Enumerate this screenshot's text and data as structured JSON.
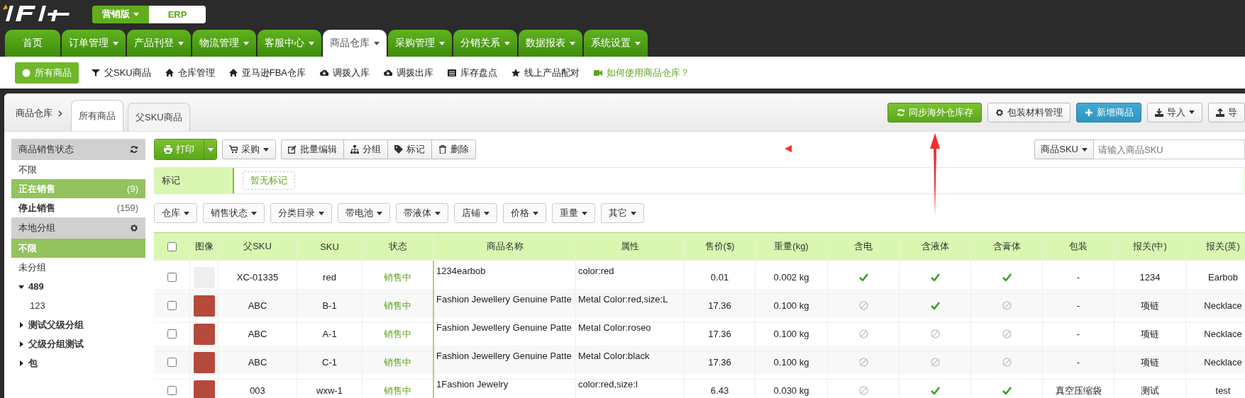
{
  "edition_switch": [
    {
      "label": "营销版",
      "kind": "dropdown",
      "selected": false
    },
    {
      "label": "ERP",
      "kind": "plain",
      "selected": true
    }
  ],
  "nav_tabs": [
    {
      "label": "首页",
      "dropdown": false,
      "selected": false
    },
    {
      "label": "订单管理",
      "dropdown": true,
      "selected": false
    },
    {
      "label": "产品刊登",
      "dropdown": true,
      "selected": false
    },
    {
      "label": "物流管理",
      "dropdown": true,
      "selected": false
    },
    {
      "label": "客服中心",
      "dropdown": true,
      "selected": false
    },
    {
      "label": "商品仓库",
      "dropdown": true,
      "selected": true
    },
    {
      "label": "采购管理",
      "dropdown": true,
      "selected": false
    },
    {
      "label": "分销关系",
      "dropdown": true,
      "selected": false
    },
    {
      "label": "数据报表",
      "dropdown": true,
      "selected": false
    },
    {
      "label": "系统设置",
      "dropdown": true,
      "selected": false
    }
  ],
  "sub_nav": [
    {
      "label": "所有商品",
      "kind": "all",
      "selected": true
    },
    {
      "label": "父SKU商品",
      "kind": "parent",
      "selected": false
    },
    {
      "label": "仓库管理",
      "kind": "warehouse",
      "selected": false
    },
    {
      "label": "亚马逊FBA仓库",
      "kind": "warehouse",
      "selected": false
    },
    {
      "label": "调拨入库",
      "kind": "transfer",
      "selected": false
    },
    {
      "label": "调拨出库",
      "kind": "transfer",
      "selected": false
    },
    {
      "label": "库存盘点",
      "kind": "stocktake",
      "selected": false
    },
    {
      "label": "线上产品配对",
      "kind": "pairing",
      "selected": false
    },
    {
      "label": "如何使用商品仓库？",
      "kind": "help",
      "selected": false
    }
  ],
  "breadcrumb": {
    "root": "商品仓库",
    "tabs": [
      {
        "label": "所有商品",
        "selected": true
      },
      {
        "label": "父SKU商品",
        "selected": false
      }
    ]
  },
  "header_buttons": [
    {
      "label": "同步海外仓库存",
      "kind": "green",
      "dropdown": false
    },
    {
      "label": "包装材料管理",
      "kind": "default",
      "dropdown": false
    },
    {
      "label": "新增商品",
      "kind": "blue",
      "dropdown": false
    },
    {
      "label": "导入",
      "kind": "default",
      "dropdown": true
    },
    {
      "label": "导",
      "kind": "default",
      "dropdown": false
    }
  ],
  "sidebar": {
    "sales_status": {
      "title": "商品销售状态",
      "items": [
        {
          "label": "不限",
          "selected": false
        },
        {
          "label": "正在销售",
          "count": "(9)",
          "selected": true
        },
        {
          "label": "停止销售",
          "count": "(159)",
          "selected": false
        }
      ]
    },
    "local_groups": {
      "title": "本地分组",
      "items": [
        {
          "label": "不限",
          "selected": true
        },
        {
          "label": "未分组",
          "selected": false
        },
        {
          "label": "489",
          "selected": false,
          "expanded": true,
          "children": [
            {
              "label": "123",
              "selected": false
            }
          ]
        },
        {
          "label": "测试父级分组",
          "selected": false,
          "expanded": false
        },
        {
          "label": "父级分组测试",
          "selected": false,
          "expanded": false
        },
        {
          "label": "包",
          "selected": false,
          "expanded": false
        }
      ]
    }
  },
  "toolbar": {
    "print": "打印",
    "buttons": [
      {
        "label": "采购",
        "dropdown": true
      },
      {
        "label": "批量编辑",
        "dropdown": false
      },
      {
        "label": "分组",
        "dropdown": false
      },
      {
        "label": "标记",
        "dropdown": false
      },
      {
        "label": "删除",
        "dropdown": false
      }
    ],
    "search_type": "商品SKU",
    "search_placeholder": "请输入商品SKU"
  },
  "mark_row": {
    "label": "标记",
    "empty_tag": "暂无标记"
  },
  "filters": [
    "仓库",
    "销售状态",
    "分类目录",
    "带电池",
    "带液体",
    "店铺",
    "价格",
    "重量",
    "其它"
  ],
  "table": {
    "all_checked": false,
    "columns": [
      "图像",
      "父SKU",
      "SKU",
      "状态",
      "商品名称",
      "属性",
      "售价($)",
      "重量(kg)",
      "含电",
      "含液体",
      "含膏体",
      "包装",
      "报关(中)",
      "报关(英)"
    ],
    "rows": [
      {
        "checked": false,
        "parent_sku": "XC-01335",
        "sku": "red",
        "status": "销售中",
        "name": "1234earbob",
        "attributes": "color:red",
        "price": "0.01",
        "weight": "0.002 kg",
        "battery": true,
        "liquid": true,
        "paste": true,
        "packaging": "-",
        "customs_cn": "1234",
        "customs_en": "Earbob"
      },
      {
        "checked": false,
        "parent_sku": "ABC",
        "sku": "B-1",
        "status": "销售中",
        "name": "Fashion Jewellery Genuine Patte",
        "attributes": "Metal Color:red,size:L",
        "price": "17.36",
        "weight": "0.100 kg",
        "battery": false,
        "liquid": true,
        "paste": false,
        "packaging": "-",
        "customs_cn": "项链",
        "customs_en": "Necklace"
      },
      {
        "checked": false,
        "parent_sku": "ABC",
        "sku": "A-1",
        "status": "销售中",
        "name": "Fashion Jewellery Genuine Patte",
        "attributes": "Metal Color:roseo",
        "price": "17.36",
        "weight": "0.100 kg",
        "battery": false,
        "liquid": false,
        "paste": false,
        "packaging": "-",
        "customs_cn": "项链",
        "customs_en": "Necklace"
      },
      {
        "checked": false,
        "parent_sku": "ABC",
        "sku": "C-1",
        "status": "销售中",
        "name": "Fashion Jewellery Genuine Patte",
        "attributes": "Metal Color:black",
        "price": "17.36",
        "weight": "0.100 kg",
        "battery": false,
        "liquid": false,
        "paste": false,
        "packaging": "-",
        "customs_cn": "项链",
        "customs_en": "Necklace"
      },
      {
        "checked": false,
        "parent_sku": "003",
        "sku": "wxw-1",
        "status": "销售中",
        "name": "1Fashion Jewelry",
        "attributes": "color:red,size:l",
        "price": "6.43",
        "weight": "0.030 kg",
        "battery": false,
        "liquid": true,
        "paste": true,
        "packaging": "真空压缩袋",
        "customs_cn": "测试",
        "customs_en": "test"
      }
    ]
  }
}
